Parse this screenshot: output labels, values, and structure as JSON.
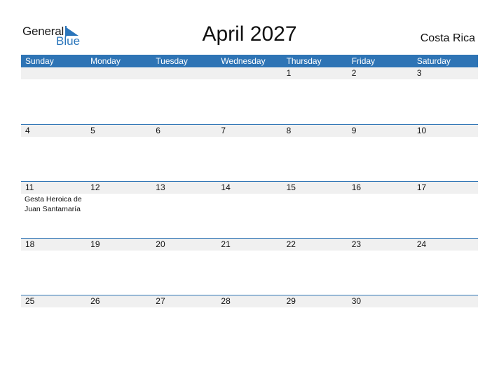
{
  "logo": {
    "general": "General",
    "blue": "Blue"
  },
  "title": "April 2027",
  "country": "Costa Rica",
  "weekdays": [
    "Sunday",
    "Monday",
    "Tuesday",
    "Wednesday",
    "Thursday",
    "Friday",
    "Saturday"
  ],
  "weeks": [
    {
      "days": [
        "",
        "",
        "",
        "",
        "1",
        "2",
        "3"
      ],
      "events": [
        "",
        "",
        "",
        "",
        "",
        "",
        ""
      ]
    },
    {
      "days": [
        "4",
        "5",
        "6",
        "7",
        "8",
        "9",
        "10"
      ],
      "events": [
        "",
        "",
        "",
        "",
        "",
        "",
        ""
      ]
    },
    {
      "days": [
        "11",
        "12",
        "13",
        "14",
        "15",
        "16",
        "17"
      ],
      "events": [
        "Gesta Heroica de Juan Santamaría",
        "",
        "",
        "",
        "",
        "",
        ""
      ]
    },
    {
      "days": [
        "18",
        "19",
        "20",
        "21",
        "22",
        "23",
        "24"
      ],
      "events": [
        "",
        "",
        "",
        "",
        "",
        "",
        ""
      ]
    },
    {
      "days": [
        "25",
        "26",
        "27",
        "28",
        "29",
        "30",
        ""
      ],
      "events": [
        "",
        "",
        "",
        "",
        "",
        "",
        ""
      ]
    }
  ],
  "colors": {
    "accent": "#2e74b5",
    "band": "#f0f0f0"
  }
}
